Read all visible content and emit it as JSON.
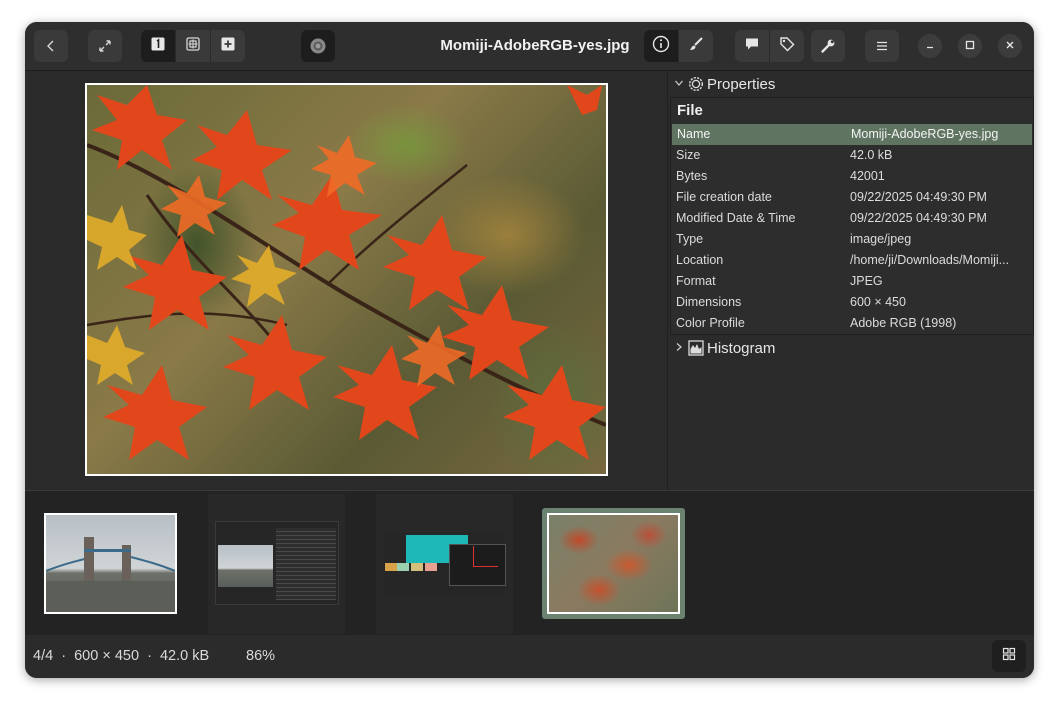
{
  "window": {
    "title": "Momiji-AdobeRGB-yes.jpg"
  },
  "headerbar": {
    "buttons": [
      {
        "name": "back-icon"
      },
      {
        "name": "fullscreen-icon"
      },
      {
        "name": "view-single-icon"
      },
      {
        "name": "view-fit-icon"
      },
      {
        "name": "view-add-icon"
      },
      {
        "name": "slideshow-icon"
      },
      {
        "name": "info-icon"
      },
      {
        "name": "paint-brush-icon"
      },
      {
        "name": "comment-icon"
      },
      {
        "name": "tag-icon"
      },
      {
        "name": "wrench-icon"
      },
      {
        "name": "menu-icon"
      },
      {
        "name": "minimize-icon"
      },
      {
        "name": "maximize-icon"
      },
      {
        "name": "close-icon"
      }
    ]
  },
  "sidebar": {
    "properties_label": "Properties",
    "group_title": "File",
    "rows": [
      {
        "key": "Name",
        "value": "Momiji-AdobeRGB-yes.jpg"
      },
      {
        "key": "Size",
        "value": "42.0 kB"
      },
      {
        "key": "Bytes",
        "value": "42001"
      },
      {
        "key": "File creation date",
        "value": "09/22/2025 04:49:30 PM"
      },
      {
        "key": "Modified Date & Time",
        "value": "09/22/2025 04:49:30 PM"
      },
      {
        "key": "Type",
        "value": "image/jpeg"
      },
      {
        "key": "Location",
        "value": "/home/ji/Downloads/Momiji..."
      },
      {
        "key": "Format",
        "value": "JPEG"
      },
      {
        "key": "Dimensions",
        "value": "600 × 450"
      },
      {
        "key": "Color Profile",
        "value": "Adobe RGB (1998)"
      }
    ],
    "histogram_label": "Histogram"
  },
  "status": {
    "summary": "4/4  ·  600 × 450  ·  42.0 kB",
    "zoom": "86%"
  },
  "colors": {
    "accent_selection": "#5f7562",
    "thumb_selected_border": "#6b8270",
    "window_bg": "#2b2b2b"
  }
}
